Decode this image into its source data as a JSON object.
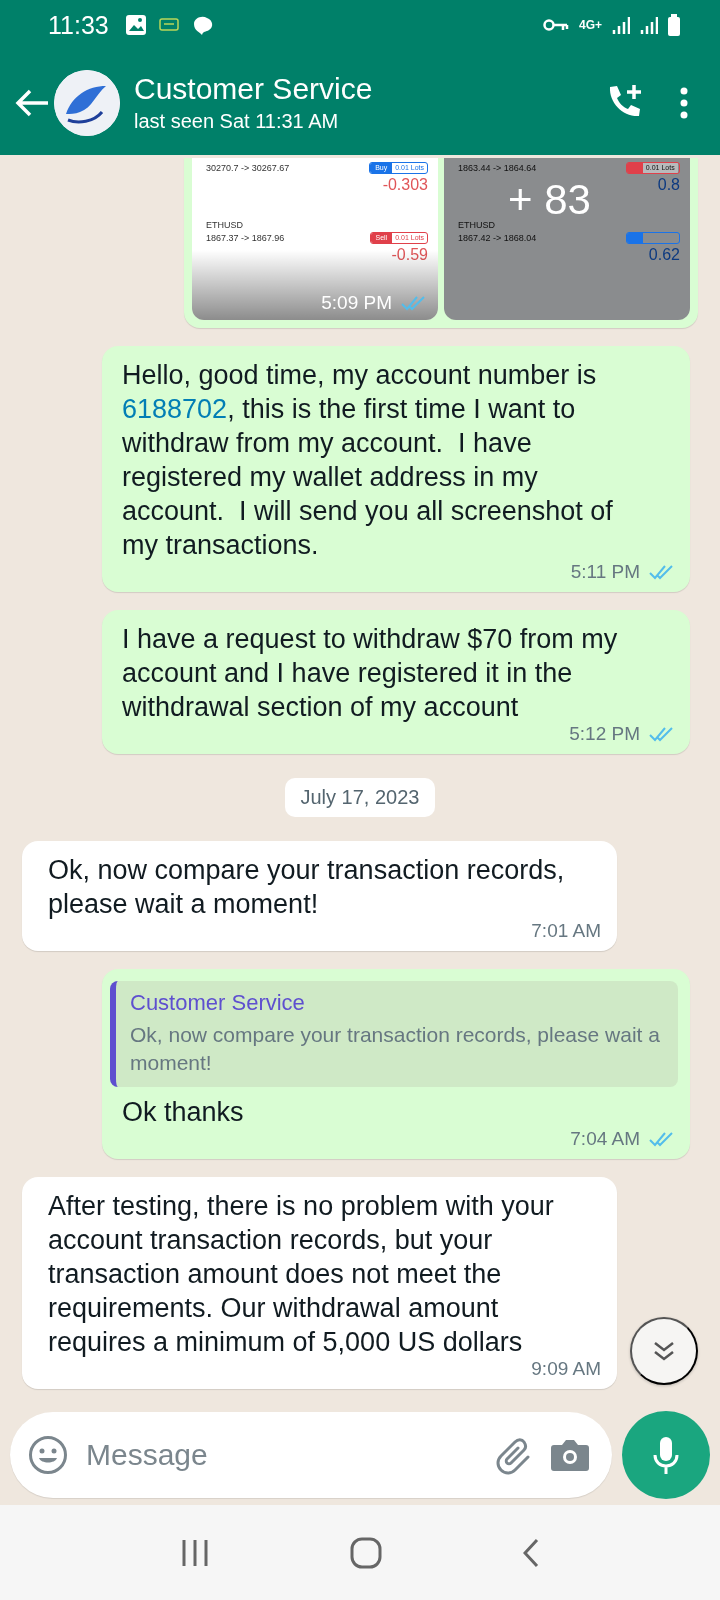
{
  "status_bar": {
    "time": "11:33",
    "network": "4G+"
  },
  "header": {
    "title": "Customer Service",
    "subtitle": "last seen Sat 11:31 AM"
  },
  "messages": [
    {
      "kind": "album",
      "outgoing": true,
      "time": "5:09 PM",
      "read": true,
      "more": "+ 83",
      "images": [
        {
          "dimmed": false,
          "trades": [
            {
              "prices": "30270.7 -> 30267.67",
              "sell": false,
              "side_label": "Buy",
              "lots": "0.01 Lots",
              "pnl": "-0.303",
              "negative": true
            },
            {
              "symbol": "ETHUSD",
              "prices": "1867.37 -> 1867.96",
              "sell": true,
              "side_label": "Sell",
              "lots": "0.01 Lots",
              "pnl": "-0.59",
              "negative": true
            }
          ]
        },
        {
          "dimmed": true,
          "trades": [
            {
              "prices": "1863.44 -> 1864.64",
              "sell": true,
              "lots": "0.01 Lots",
              "pnl": "0.8",
              "negative": false
            },
            {
              "symbol": "ETHUSD",
              "prices": "1867.42 -> 1868.04",
              "sell": false,
              "pnl": "0.62",
              "negative": false
            }
          ]
        }
      ]
    },
    {
      "kind": "text",
      "outgoing": true,
      "parts": [
        {
          "kind": "plain",
          "text": "Hello, good time, my account number is "
        },
        {
          "kind": "link",
          "text": "6188702"
        },
        {
          "kind": "plain",
          "text": ", this is the first time I want to withdraw from my account.  I have registered my wallet address in my account.  I will send you all screenshot of my transactions."
        }
      ],
      "time": "5:11 PM",
      "read": true
    },
    {
      "kind": "text",
      "outgoing": true,
      "parts": [
        {
          "kind": "plain",
          "text": "I have a request to withdraw $70 from my account and I have registered it in the withdrawal section of my account"
        }
      ],
      "time": "5:12 PM",
      "read": true
    },
    {
      "kind": "date",
      "text": "July 17, 2023"
    },
    {
      "kind": "text",
      "outgoing": false,
      "parts": [
        {
          "kind": "plain",
          "text": "Ok, now compare your transaction records, please wait a moment!"
        }
      ],
      "time": "7:01 AM"
    },
    {
      "kind": "text",
      "outgoing": true,
      "quote": {
        "author": "Customer Service",
        "text": "Ok, now compare your transaction records, please wait a moment!"
      },
      "parts": [
        {
          "kind": "plain",
          "text": "Ok thanks"
        }
      ],
      "time": "7:04 AM",
      "read": true
    },
    {
      "kind": "text",
      "outgoing": false,
      "parts": [
        {
          "kind": "plain",
          "text": "After testing, there is no problem with your account transaction records, but your transaction amount does not meet the requirements. Our withdrawal amount requires a minimum of 5,000 US dollars"
        }
      ],
      "time": "9:09 AM"
    }
  ],
  "composer": {
    "placeholder": "Message"
  }
}
